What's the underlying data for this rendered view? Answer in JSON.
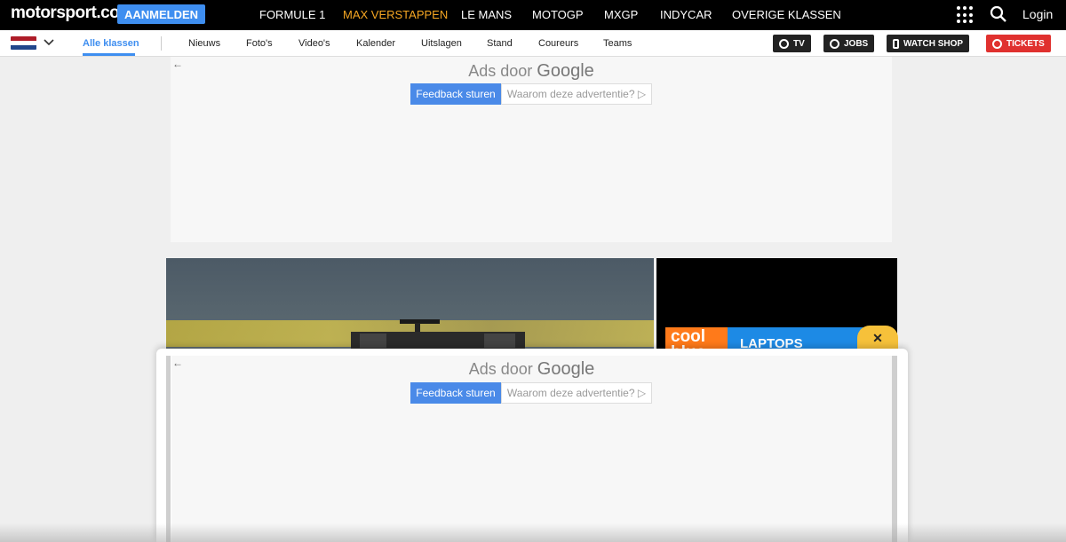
{
  "header": {
    "logo": "motorsport.com",
    "signup_label": "AANMELDEN",
    "nav": [
      {
        "label": "FORMULE 1"
      },
      {
        "label": "MAX VERSTAPPEN"
      },
      {
        "label": "LE MANS"
      },
      {
        "label": "MOTOGP"
      },
      {
        "label": "MXGP"
      },
      {
        "label": "INDYCAR"
      },
      {
        "label": "OVERIGE KLASSEN"
      }
    ],
    "login_label": "Login"
  },
  "subnav": {
    "items": [
      {
        "label": "Alle klassen"
      },
      {
        "label": "Nieuws"
      },
      {
        "label": "Foto's"
      },
      {
        "label": "Video's"
      },
      {
        "label": "Kalender"
      },
      {
        "label": "Uitslagen"
      },
      {
        "label": "Stand"
      },
      {
        "label": "Coureurs"
      },
      {
        "label": "Teams"
      }
    ],
    "pills": [
      {
        "label": "TV"
      },
      {
        "label": "JOBS"
      },
      {
        "label": "WATCH SHOP"
      },
      {
        "label": "TICKETS"
      }
    ]
  },
  "ads": {
    "title_prefix": "Ads door",
    "title_brand": "Google",
    "feedback_label": "Feedback sturen",
    "why_label": "Waarom deze advertentie? ▷",
    "back_arrow": "←"
  },
  "side_ad": {
    "logo": "cool blue",
    "text": "LAPTOPS",
    "close": "✕"
  },
  "colors": {
    "accent": "#3e8ef0",
    "active_nav": "#f5a623",
    "tickets": "#e0312f"
  }
}
